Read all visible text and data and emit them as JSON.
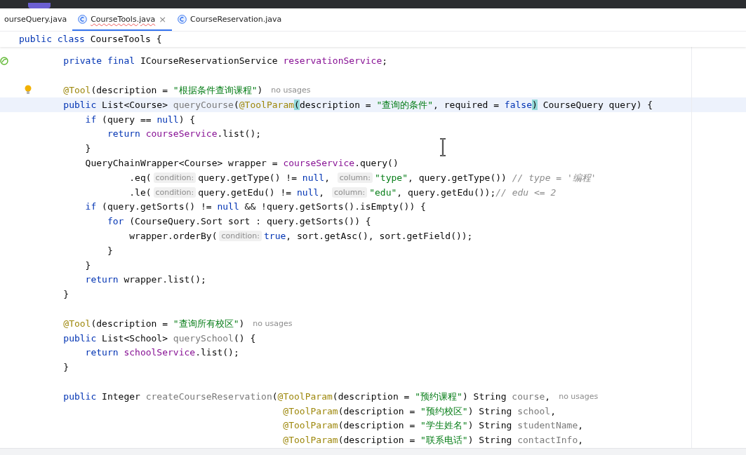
{
  "tabs": [
    {
      "label": "ourseQuery.java",
      "selected": false
    },
    {
      "label": "CourseTools.java",
      "selected": true,
      "close": "×"
    },
    {
      "label": "CourseReservation.java",
      "selected": false
    }
  ],
  "sticky_header": [
    {
      "kind": "keyword",
      "text": "public class "
    },
    {
      "kind": "plain",
      "text": "CourseTools {"
    }
  ],
  "lines": [
    {
      "marker": {
        "kind": "bean"
      },
      "current": false,
      "tokens": [
        {
          "kind": "keyword",
          "text": "    private final "
        },
        {
          "kind": "plain",
          "text": "ICourseReservationService "
        },
        {
          "kind": "field",
          "text": "reservationService"
        },
        {
          "kind": "plain",
          "text": ";"
        }
      ]
    },
    {
      "current": false
    },
    {
      "marker": {
        "kind": "bulb"
      },
      "current": false,
      "tokens": [
        {
          "kind": "annotation",
          "text": "    @Tool"
        },
        {
          "kind": "plain",
          "text": "(description = "
        },
        {
          "kind": "string",
          "text": "\"根据条件查询课程\""
        },
        {
          "kind": "plain",
          "text": ")"
        },
        {
          "kind": "usage",
          "text": "no usages"
        }
      ]
    },
    {
      "current": true,
      "tokens": [
        {
          "kind": "keyword",
          "text": "    public "
        },
        {
          "kind": "plain",
          "text": "List<Course> "
        },
        {
          "kind": "method",
          "text": "queryCourse"
        },
        {
          "kind": "plain",
          "text": "("
        },
        {
          "kind": "annotation",
          "text": "@ToolParam"
        },
        {
          "kind": "match",
          "text": "("
        },
        {
          "kind": "plain",
          "text": "description = "
        },
        {
          "kind": "string",
          "text": "\"查询的条件\""
        },
        {
          "kind": "plain",
          "text": ", required = "
        },
        {
          "kind": "keyword",
          "text": "false"
        },
        {
          "kind": "match",
          "text": ")"
        },
        {
          "kind": "plain",
          "text": " CourseQuery query) {"
        }
      ]
    },
    {
      "current": false,
      "tokens": [
        {
          "kind": "keyword",
          "text": "        if "
        },
        {
          "kind": "plain",
          "text": "(query == "
        },
        {
          "kind": "keyword",
          "text": "null"
        },
        {
          "kind": "plain",
          "text": ") {"
        }
      ]
    },
    {
      "current": false,
      "tokens": [
        {
          "kind": "keyword",
          "text": "            return "
        },
        {
          "kind": "field",
          "text": "courseService"
        },
        {
          "kind": "plain",
          "text": ".list();"
        }
      ]
    },
    {
      "current": false,
      "tokens": [
        {
          "kind": "plain",
          "text": "        }"
        }
      ]
    },
    {
      "current": false,
      "tokens": [
        {
          "kind": "plain",
          "text": "        QueryChainWrapper<Course> wrapper = "
        },
        {
          "kind": "field",
          "text": "courseService"
        },
        {
          "kind": "plain",
          "text": ".query()"
        }
      ]
    },
    {
      "current": false,
      "tokens": [
        {
          "kind": "plain",
          "text": "                .eq("
        },
        {
          "kind": "hint",
          "text": "condition:"
        },
        {
          "kind": "plain",
          "text": "query.getType() != "
        },
        {
          "kind": "keyword",
          "text": "null"
        },
        {
          "kind": "plain",
          "text": ", "
        },
        {
          "kind": "hint",
          "text": "column:"
        },
        {
          "kind": "string",
          "text": "\"type\""
        },
        {
          "kind": "plain",
          "text": ", query.getType()) "
        },
        {
          "kind": "comment",
          "text": "// type = '编程'"
        }
      ]
    },
    {
      "current": false,
      "tokens": [
        {
          "kind": "plain",
          "text": "                .le("
        },
        {
          "kind": "hint",
          "text": "condition:"
        },
        {
          "kind": "plain",
          "text": "query.getEdu() != "
        },
        {
          "kind": "keyword",
          "text": "null"
        },
        {
          "kind": "plain",
          "text": ", "
        },
        {
          "kind": "hint",
          "text": "column:"
        },
        {
          "kind": "string",
          "text": "\"edu\""
        },
        {
          "kind": "plain",
          "text": ", query.getEdu());"
        },
        {
          "kind": "comment",
          "text": "// edu <= 2"
        }
      ]
    },
    {
      "current": false,
      "tokens": [
        {
          "kind": "keyword",
          "text": "        if "
        },
        {
          "kind": "plain",
          "text": "(query.getSorts() != "
        },
        {
          "kind": "keyword",
          "text": "null"
        },
        {
          "kind": "plain",
          "text": " && !query.getSorts().isEmpty()) {"
        }
      ]
    },
    {
      "current": false,
      "tokens": [
        {
          "kind": "keyword",
          "text": "            for "
        },
        {
          "kind": "plain",
          "text": "(CourseQuery.Sort sort : query.getSorts()) {"
        }
      ]
    },
    {
      "current": false,
      "tokens": [
        {
          "kind": "plain",
          "text": "                wrapper.orderBy("
        },
        {
          "kind": "hint",
          "text": "condition:"
        },
        {
          "kind": "keyword",
          "text": "true"
        },
        {
          "kind": "plain",
          "text": ", sort.getAsc(), sort.getField());"
        }
      ]
    },
    {
      "current": false,
      "tokens": [
        {
          "kind": "plain",
          "text": "            }"
        }
      ]
    },
    {
      "current": false,
      "tokens": [
        {
          "kind": "plain",
          "text": "        }"
        }
      ]
    },
    {
      "current": false,
      "tokens": [
        {
          "kind": "keyword",
          "text": "        return "
        },
        {
          "kind": "plain",
          "text": "wrapper.list();"
        }
      ]
    },
    {
      "current": false,
      "tokens": [
        {
          "kind": "plain",
          "text": "    }"
        }
      ]
    },
    {
      "current": false
    },
    {
      "current": false,
      "tokens": [
        {
          "kind": "annotation",
          "text": "    @Tool"
        },
        {
          "kind": "plain",
          "text": "(description = "
        },
        {
          "kind": "string",
          "text": "\"查询所有校区\""
        },
        {
          "kind": "plain",
          "text": ")"
        },
        {
          "kind": "usage",
          "text": "no usages"
        }
      ]
    },
    {
      "current": false,
      "tokens": [
        {
          "kind": "keyword",
          "text": "    public "
        },
        {
          "kind": "plain",
          "text": "List<School> "
        },
        {
          "kind": "method",
          "text": "querySchool"
        },
        {
          "kind": "plain",
          "text": "() {"
        }
      ]
    },
    {
      "current": false,
      "tokens": [
        {
          "kind": "keyword",
          "text": "        return "
        },
        {
          "kind": "field",
          "text": "schoolService"
        },
        {
          "kind": "plain",
          "text": ".list();"
        }
      ]
    },
    {
      "current": false,
      "tokens": [
        {
          "kind": "plain",
          "text": "    }"
        }
      ]
    },
    {
      "current": false
    },
    {
      "current": false,
      "tokens": [
        {
          "kind": "keyword",
          "text": "    public "
        },
        {
          "kind": "plain",
          "text": "Integer "
        },
        {
          "kind": "method",
          "text": "createCourseReservation"
        },
        {
          "kind": "plain",
          "text": "("
        },
        {
          "kind": "annotation",
          "text": "@ToolParam"
        },
        {
          "kind": "plain",
          "text": "(description = "
        },
        {
          "kind": "string",
          "text": "\"预约课程\""
        },
        {
          "kind": "plain",
          "text": ") String "
        },
        {
          "kind": "method",
          "text": "course"
        },
        {
          "kind": "plain",
          "text": ","
        },
        {
          "kind": "usage",
          "text": "no usages"
        }
      ]
    },
    {
      "current": false,
      "tokens": [
        {
          "kind": "annotation",
          "text": "                                            @ToolParam"
        },
        {
          "kind": "plain",
          "text": "(description = "
        },
        {
          "kind": "string",
          "text": "\"预约校区\""
        },
        {
          "kind": "plain",
          "text": ") String "
        },
        {
          "kind": "method",
          "text": "school"
        },
        {
          "kind": "plain",
          "text": ","
        }
      ]
    },
    {
      "current": false,
      "tokens": [
        {
          "kind": "annotation",
          "text": "                                            @ToolParam"
        },
        {
          "kind": "plain",
          "text": "(description = "
        },
        {
          "kind": "string",
          "text": "\"学生姓名\""
        },
        {
          "kind": "plain",
          "text": ") String "
        },
        {
          "kind": "method",
          "text": "studentName"
        },
        {
          "kind": "plain",
          "text": ","
        }
      ]
    },
    {
      "current": false,
      "tokens": [
        {
          "kind": "annotation",
          "text": "                                            @ToolParam"
        },
        {
          "kind": "plain",
          "text": "(description = "
        },
        {
          "kind": "string",
          "text": "\"联系电话\""
        },
        {
          "kind": "plain",
          "text": ") String "
        },
        {
          "kind": "method",
          "text": "contactInfo"
        },
        {
          "kind": "plain",
          "text": ","
        }
      ]
    }
  ]
}
